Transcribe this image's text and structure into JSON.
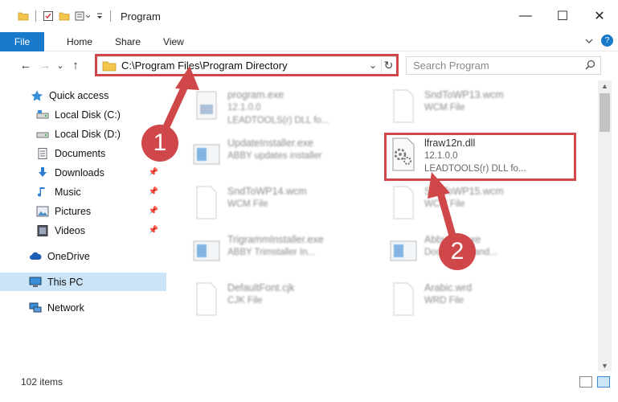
{
  "window": {
    "title": "Program",
    "minimize": "—",
    "maximize": "☐",
    "close": "✕"
  },
  "ribbon": {
    "tabs": [
      "File",
      "Home",
      "Share",
      "View"
    ],
    "help": "?"
  },
  "nav": {
    "back": "←",
    "forward": "→",
    "recent": "⌄",
    "up": "↑",
    "address": "C:\\Program Files\\Program Directory",
    "search_placeholder": "Search Program"
  },
  "sidebar": {
    "items": [
      {
        "label": "Quick access",
        "icon": "star-icon"
      },
      {
        "label": "Local Disk (C:)",
        "icon": "drive-icon"
      },
      {
        "label": "Local Disk (D:)",
        "icon": "drive-icon"
      },
      {
        "label": "Documents",
        "icon": "documents-icon"
      },
      {
        "label": "Downloads",
        "icon": "download-icon"
      },
      {
        "label": "Music",
        "icon": "music-icon"
      },
      {
        "label": "Pictures",
        "icon": "pictures-icon"
      },
      {
        "label": "Videos",
        "icon": "videos-icon"
      },
      {
        "label": "OneDrive",
        "icon": "cloud-icon"
      },
      {
        "label": "This PC",
        "icon": "computer-icon"
      },
      {
        "label": "Network",
        "icon": "network-icon"
      }
    ]
  },
  "files": [
    {
      "name": "program.exe",
      "sub1": "12.1.0.0",
      "sub2": "LEADTOOLS(r) DLL fo...",
      "icon": "exe-icon"
    },
    {
      "name": "SndToWP13.wcm",
      "sub1": "WCM File",
      "sub2": "",
      "icon": "blank-file-icon"
    },
    {
      "name": "UpdateInstaller.exe",
      "sub1": "ABBY updates installer",
      "sub2": "",
      "icon": "window-app-icon"
    },
    {
      "name": "lfraw12n.dll",
      "sub1": "12.1.0.0",
      "sub2": "LEADTOOLS(r) DLL fo...",
      "icon": "dll-gear-icon"
    },
    {
      "name": "SndToWP14.wcm",
      "sub1": "WCM File",
      "sub2": "",
      "icon": "blank-file-icon"
    },
    {
      "name": "SndToWP15.wcm",
      "sub1": "WCM File",
      "sub2": "",
      "icon": "blank-file-icon"
    },
    {
      "name": "TrigrammInstaller.exe",
      "sub1": "ABBY Trimstaller In...",
      "sub2": "",
      "icon": "window-app-icon"
    },
    {
      "name": "AbbyCN.exe",
      "sub1": "Document hand...",
      "sub2": "",
      "icon": "window-app-icon"
    },
    {
      "name": "DefaultFont.cjk",
      "sub1": "CJK File",
      "sub2": "",
      "icon": "blank-file-icon"
    },
    {
      "name": "Arabic.wrd",
      "sub1": "WRD File",
      "sub2": "",
      "icon": "blank-file-icon"
    }
  ],
  "status": {
    "item_count": "102 items"
  },
  "callouts": {
    "one": "1",
    "two": "2"
  }
}
